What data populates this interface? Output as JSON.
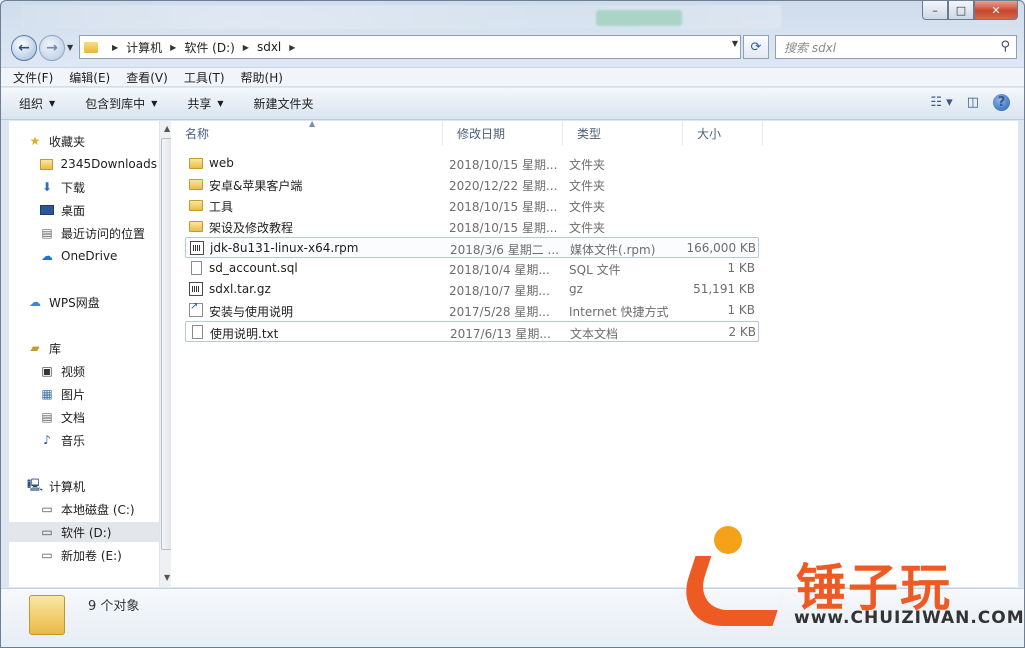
{
  "window": {
    "min_label": "▭",
    "max_label": "□",
    "close_label": "✕"
  },
  "address": {
    "crumbs": [
      "计算机",
      "软件 (D:)",
      "sdxl"
    ],
    "search_placeholder": "搜索 sdxl"
  },
  "menu": [
    "文件(F)",
    "编辑(E)",
    "查看(V)",
    "工具(T)",
    "帮助(H)"
  ],
  "commands": {
    "organize": "组织",
    "include_library": "包含到库中",
    "share": "共享",
    "new_folder": "新建文件夹"
  },
  "sidebar": {
    "favorites": "收藏夹",
    "fav_items": [
      "2345Downloads",
      "下载",
      "桌面",
      "最近访问的位置",
      "OneDrive"
    ],
    "wps": "WPS网盘",
    "library": "库",
    "lib_items": [
      "视频",
      "图片",
      "文档",
      "音乐"
    ],
    "computer": "计算机",
    "drives": [
      "本地磁盘 (C:)",
      "软件 (D:)",
      "新加卷 (E:)"
    ]
  },
  "columns": {
    "name": "名称",
    "date": "修改日期",
    "type": "类型",
    "size": "大小"
  },
  "files": [
    {
      "name": "web",
      "date": "2018/10/15 星期...",
      "type": "文件夹",
      "size": "",
      "icon": "folder-icon"
    },
    {
      "name": "安卓&苹果客户端",
      "date": "2020/12/22 星期...",
      "type": "文件夹",
      "size": "",
      "icon": "folder-icon"
    },
    {
      "name": "工具",
      "date": "2018/10/15 星期...",
      "type": "文件夹",
      "size": "",
      "icon": "folder-icon"
    },
    {
      "name": "架设及修改教程",
      "date": "2018/10/15 星期...",
      "type": "文件夹",
      "size": "",
      "icon": "folder-icon"
    },
    {
      "name": "jdk-8u131-linux-x64.rpm",
      "date": "2018/3/6 星期二 ...",
      "type": "媒体文件(.rpm)",
      "size": "166,000 KB",
      "icon": "media-file-icon"
    },
    {
      "name": "sd_account.sql",
      "date": "2018/10/4 星期...",
      "type": "SQL 文件",
      "size": "1 KB",
      "icon": "file-icon"
    },
    {
      "name": "sdxl.tar.gz",
      "date": "2018/10/7 星期...",
      "type": "gz",
      "size": "51,191 KB",
      "icon": "media-file-icon"
    },
    {
      "name": "安装与使用说明",
      "date": "2017/5/28 星期...",
      "type": "Internet 快捷方式",
      "size": "1 KB",
      "icon": "shortcut-icon"
    },
    {
      "name": "使用说明.txt",
      "date": "2017/6/13 星期...",
      "type": "文本文档",
      "size": "2 KB",
      "icon": "file-icon"
    }
  ],
  "status": {
    "count": "9 个对象"
  },
  "watermark": {
    "cn": "锤子玩",
    "en": "www.CHUIZIWAN.COM"
  }
}
